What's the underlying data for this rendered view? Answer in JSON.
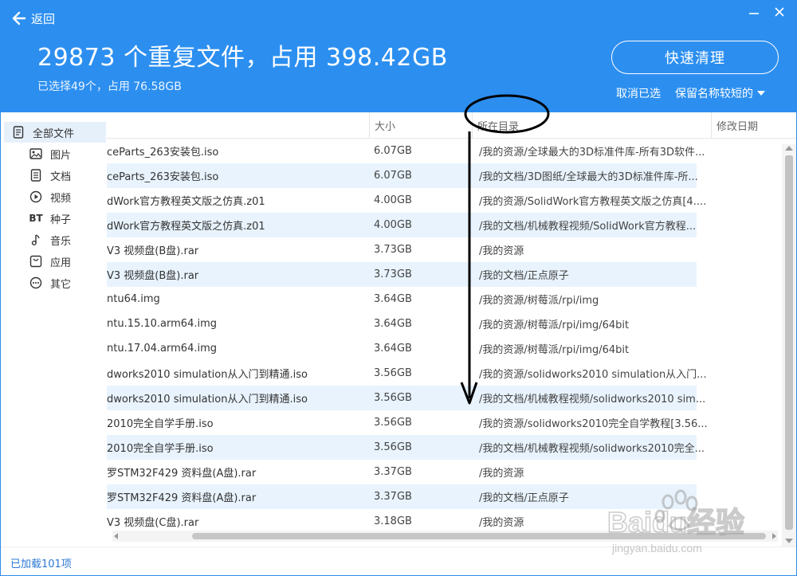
{
  "header": {
    "back_label": "返回",
    "title": "29873 个重复文件，占用 398.42GB",
    "subtitle": "已选择49个，占用 76.58GB",
    "quick_clean_label": "快速清理",
    "cancel_selection_label": "取消已选",
    "keep_rule_label": "保留名称较短的"
  },
  "sidebar": {
    "items": [
      {
        "label": "全部文件",
        "icon": "all-files-icon"
      },
      {
        "label": "图片",
        "icon": "image-icon"
      },
      {
        "label": "文档",
        "icon": "document-icon"
      },
      {
        "label": "视频",
        "icon": "video-icon"
      },
      {
        "label": "种子",
        "icon": "bt-torrent-icon",
        "glyph": "BT"
      },
      {
        "label": "音乐",
        "icon": "music-icon"
      },
      {
        "label": "应用",
        "icon": "app-icon"
      },
      {
        "label": "其它",
        "icon": "other-icon"
      }
    ]
  },
  "table": {
    "columns": {
      "size": "大小",
      "dir": "所在目录",
      "date": "修改日期"
    },
    "rows": [
      {
        "name": "ceParts_263安装包.iso",
        "size": "6.07GB",
        "dir": "/我的资源/全球最大的3D标准件库-所有3D软件..."
      },
      {
        "name": "ceParts_263安装包.iso",
        "size": "6.07GB",
        "dir": "/我的文档/3D图纸/全球最大的3D标准件库-所..."
      },
      {
        "name": "dWork官方教程英文版之仿真.z01",
        "size": "4.00GB",
        "dir": "/我的资源/SolidWork官方教程英文版之仿真[4...."
      },
      {
        "name": "dWork官方教程英文版之仿真.z01",
        "size": "4.00GB",
        "dir": "/我的文档/机械教程视频/SolidWork官方教程..."
      },
      {
        "name": "V3 视频盘(B盘).rar",
        "size": "3.73GB",
        "dir": "/我的资源"
      },
      {
        "name": "V3 视频盘(B盘).rar",
        "size": "3.73GB",
        "dir": "/我的文档/正点原子"
      },
      {
        "name": "ntu64.img",
        "size": "3.64GB",
        "dir": "/我的资源/树莓派/rpi/img"
      },
      {
        "name": "ntu.15.10.arm64.img",
        "size": "3.64GB",
        "dir": "/我的资源/树莓派/rpi/img/64bit"
      },
      {
        "name": "ntu.17.04.arm64.img",
        "size": "3.64GB",
        "dir": "/我的资源/树莓派/rpi/img/64bit"
      },
      {
        "name": "dworks2010 simulation从入门到精通.iso",
        "size": "3.56GB",
        "dir": "/我的资源/solidworks2010 simulation从入门..."
      },
      {
        "name": "dworks2010 simulation从入门到精通.iso",
        "size": "3.56GB",
        "dir": "/我的文档/机械教程视频/solidworks2010 sim..."
      },
      {
        "name": "2010完全自学手册.iso",
        "size": "3.56GB",
        "dir": "/我的资源/solidworks2010完全自学教程[3.56..."
      },
      {
        "name": "2010完全自学手册.iso",
        "size": "3.56GB",
        "dir": "/我的文档/机械教程视频/solidworks2010完全..."
      },
      {
        "name": "罗STM32F429 资料盘(A盘).rar",
        "size": "3.37GB",
        "dir": "/我的资源"
      },
      {
        "name": "罗STM32F429 资料盘(A盘).rar",
        "size": "3.37GB",
        "dir": "/我的文档/正点原子"
      },
      {
        "name": "V3 视频盘(C盘).rar",
        "size": "3.18GB",
        "dir": "/我的资源"
      }
    ]
  },
  "footer": {
    "loaded_label": "已加载101项"
  },
  "watermark": {
    "brand": "Baidu经验",
    "url": "jingyan.baidu.com"
  },
  "colors": {
    "accent": "#2c8ff0",
    "row_alt": "#e8f3fd",
    "link": "#2c79d4"
  }
}
